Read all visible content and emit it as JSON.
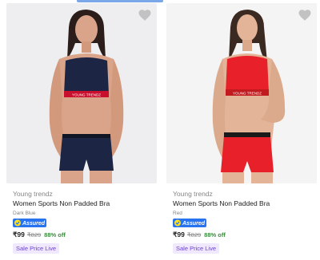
{
  "products": [
    {
      "brand": "Young trendz",
      "title": "Women Sports Non Padded Bra",
      "variant": "Dark Blue",
      "assured_label": "Assured",
      "price": "₹99",
      "mrp": "₹829",
      "discount": "88% off",
      "badge": "Sale Price Live",
      "set_color": "#1c2544",
      "band_text": "YOUNG TRENDZ",
      "backdrop": "#eeeef0"
    },
    {
      "brand": "Young trendz",
      "title": "Women Sports Non Padded Bra",
      "variant": "Red",
      "assured_label": "Assured",
      "price": "₹99",
      "mrp": "₹829",
      "discount": "88% off",
      "badge": "Sale Price Live",
      "set_color": "#e8202a",
      "band_text": "YOUNG TRENDZ",
      "backdrop": "#f4f4f4"
    }
  ],
  "colors": {
    "accent": "#2874f0",
    "price_green": "#388e3c",
    "badge_purple": "#6e3fd2"
  }
}
